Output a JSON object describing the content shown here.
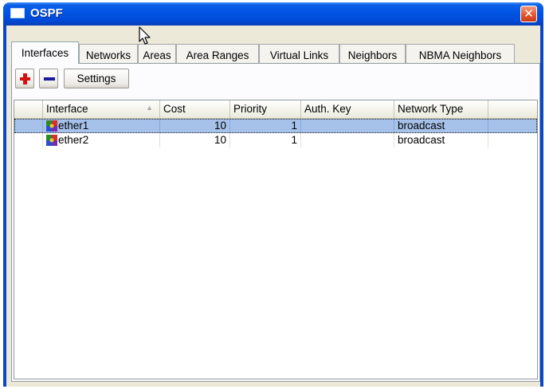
{
  "window": {
    "title": "OSPF",
    "close_glyph": "✕"
  },
  "tabs": [
    {
      "label": "Interfaces",
      "active": true
    },
    {
      "label": "Networks"
    },
    {
      "label": "Areas"
    },
    {
      "label": "Area Ranges"
    },
    {
      "label": "Virtual Links"
    },
    {
      "label": "Neighbors"
    },
    {
      "label": "NBMA Neighbors"
    }
  ],
  "toolbar": {
    "add_icon": "plus-icon",
    "remove_icon": "minus-icon",
    "settings_label": "Settings"
  },
  "table": {
    "columns": [
      "Interface",
      "Cost",
      "Priority",
      "Auth. Key",
      "Network Type"
    ],
    "rows": [
      {
        "interface": "ether1",
        "cost": "10",
        "priority": "1",
        "auth_key": "",
        "network_type": "broadcast",
        "selected": true
      },
      {
        "interface": "ether2",
        "cost": "10",
        "priority": "1",
        "auth_key": "",
        "network_type": "broadcast",
        "selected": false
      }
    ]
  },
  "colors": {
    "titlebar": "#0054e3",
    "selection": "#a6c2ea",
    "close": "#e2582f"
  }
}
